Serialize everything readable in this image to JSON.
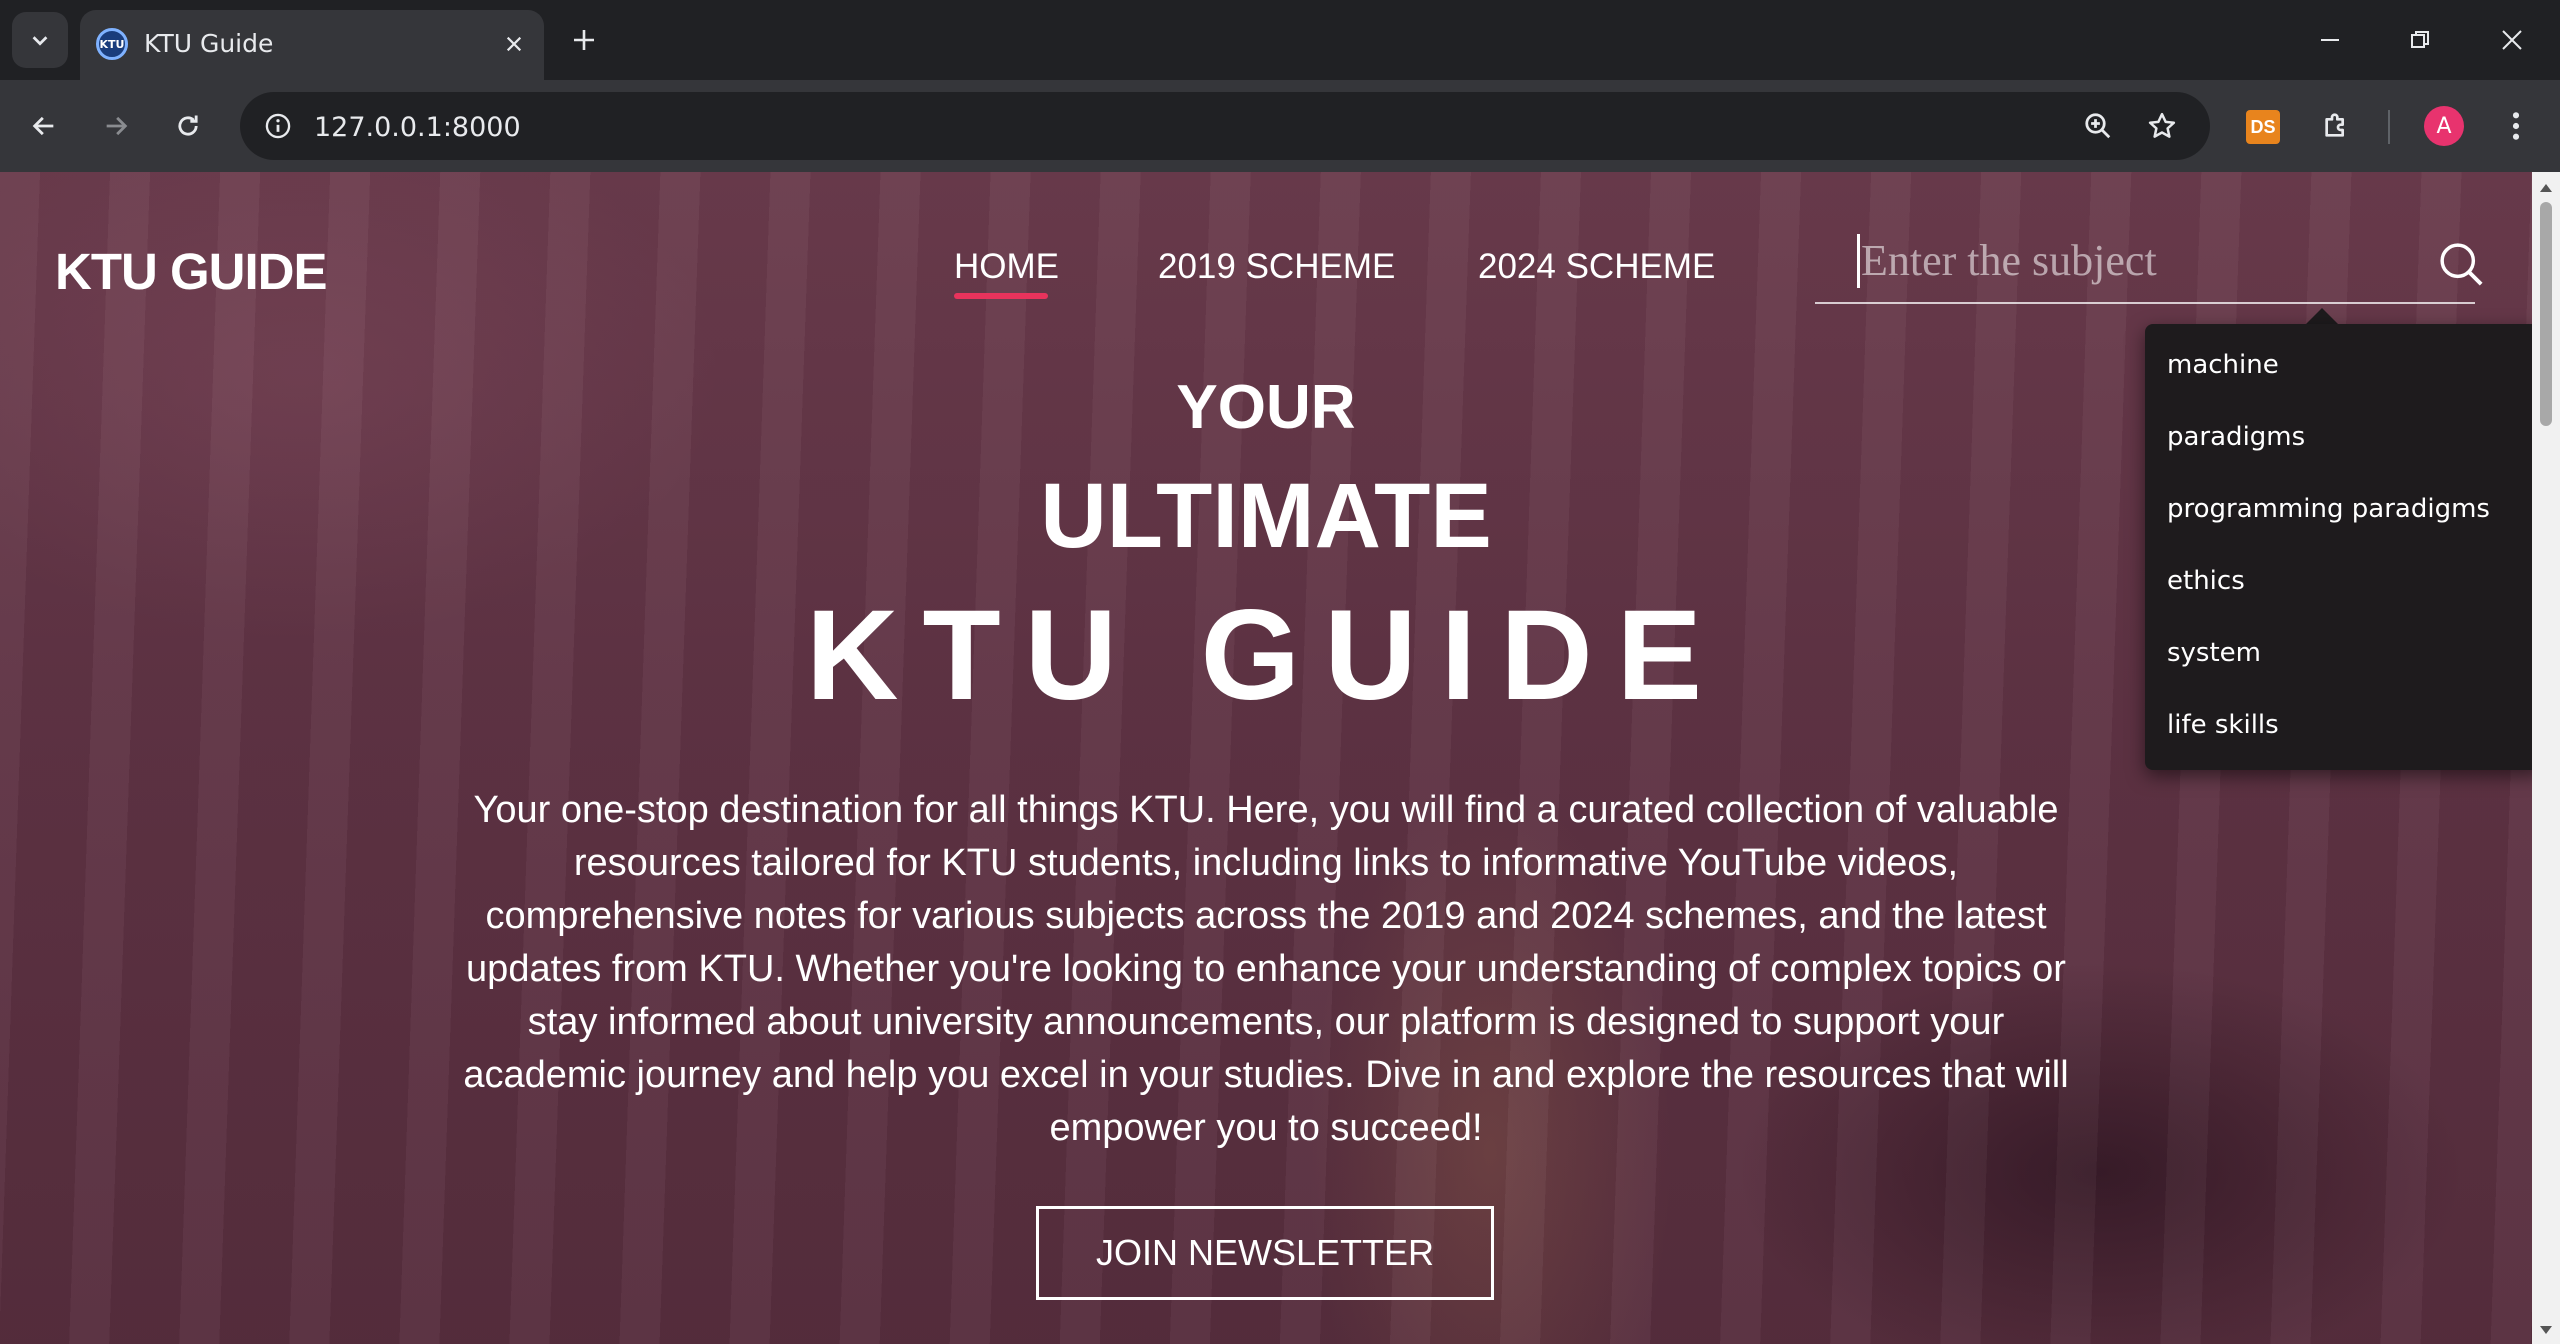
{
  "browser": {
    "tab_title": "KTU Guide",
    "favicon_text": "KTU",
    "url": "127.0.0.1:8000",
    "extension_badge": "DS",
    "profile_initial": "A"
  },
  "site": {
    "brand": "KTU GUIDE",
    "nav": [
      {
        "label": "HOME",
        "active": true
      },
      {
        "label": "2019 SCHEME",
        "active": false
      },
      {
        "label": "2024 SCHEME",
        "active": false
      }
    ],
    "search_placeholder": "Enter the subject",
    "suggestions": [
      "machine",
      "paradigms",
      "programming paradigms",
      "ethics",
      "system",
      "life skills"
    ]
  },
  "hero": {
    "line1": "YOUR",
    "line2": "ULTIMATE",
    "line3": "KTU GUIDE",
    "description": "Your one-stop destination for all things KTU. Here, you will find a curated collection of valuable resources tailored for KTU students, including links to informative YouTube videos, comprehensive notes for various subjects across the 2019 and 2024 schemes, and the latest updates from KTU. Whether you're looking to enhance your understanding of complex topics or stay informed about university announcements, our platform is designed to support your academic journey and help you excel in your studies. Dive in and explore the resources that will empower you to succeed!",
    "cta": "JOIN NEWSLETTER"
  },
  "colors": {
    "accent": "#e8335c",
    "overlay": "#5f3344"
  }
}
